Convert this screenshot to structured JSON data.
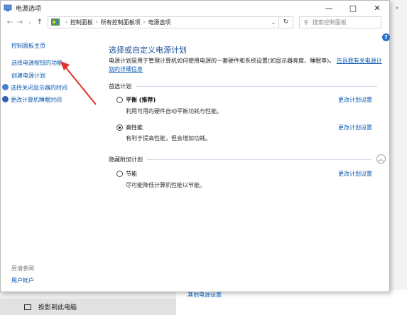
{
  "window": {
    "title": "电源选项"
  },
  "address": {
    "crumbs": [
      "控制面板",
      "所有控制面板项",
      "电源选项"
    ],
    "search_placeholder": "搜索控制面板"
  },
  "sidebar": {
    "items": [
      {
        "label": "控制面板主页"
      },
      {
        "label": "选择电源按钮的功能"
      },
      {
        "label": "创建电源计划"
      },
      {
        "label": "选择关闭显示器的时间"
      },
      {
        "label": "更改计算机睡眠时间"
      }
    ],
    "see_also": "另请参阅",
    "user_accounts": "用户帐户"
  },
  "main": {
    "title": "选择或自定义电源计划",
    "desc": "电源计划是用于管理计算机如何使用电源的一套硬件和系统设置(如显示器亮度、睡眠等)。",
    "desc_link": "告诉我有关电源计划的详细信息",
    "preferred_section": "首选计划",
    "hidden_section": "隐藏附加计划",
    "plans": [
      {
        "name": "平衡 (推荐)",
        "desc": "利用可用的硬件自动平衡功耗与性能。",
        "link": "更改计划设置",
        "selected": false
      },
      {
        "name": "高性能",
        "desc": "有利于提高性能，但会增加功耗。",
        "link": "更改计划设置",
        "selected": true
      },
      {
        "name": "节能",
        "desc": "尽可能降低计算机性能以节能。",
        "link": "更改计划设置",
        "selected": false
      }
    ]
  },
  "background": {
    "project_label": "投影到此电脑",
    "link": "其他电源设置"
  },
  "colors": {
    "accent": "#0b58b0",
    "title": "#1d4e9a",
    "arrow": "#e0312a"
  }
}
